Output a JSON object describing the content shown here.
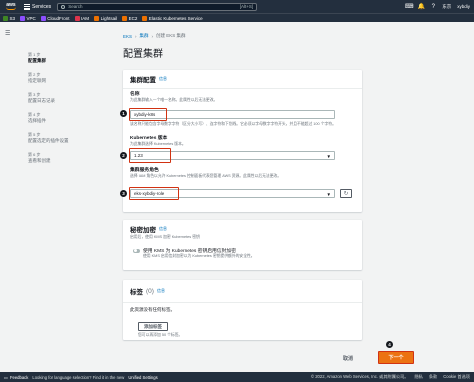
{
  "topnav": {
    "logo": "aws",
    "services_label": "Services",
    "search_placeholder": "Search",
    "search_shortcut": "[Alt+S]",
    "region": "东京",
    "user": "xybdiy"
  },
  "favorites": [
    {
      "label": "S3",
      "color": "#3f8624"
    },
    {
      "label": "VPC",
      "color": "#8c4fff"
    },
    {
      "label": "CloudFront",
      "color": "#8c4fff"
    },
    {
      "label": "IAM",
      "color": "#dd344c"
    },
    {
      "label": "Lightsail",
      "color": "#ed7100"
    },
    {
      "label": "EC2",
      "color": "#ed7100"
    },
    {
      "label": "Elastic Kubernetes Service",
      "color": "#ed7100"
    }
  ],
  "steps": [
    {
      "num": "第 1 步",
      "name": "配置集群"
    },
    {
      "num": "第 2 步",
      "name": "指定联网"
    },
    {
      "num": "第 3 步",
      "name": "配置日志记录"
    },
    {
      "num": "第 4 步",
      "name": "选择插件"
    },
    {
      "num": "第 5 步",
      "name": "配置选定的插件设置"
    },
    {
      "num": "第 6 步",
      "name": "查看和创建"
    }
  ],
  "breadcrumb": {
    "eks": "EKS",
    "clusters": "集群",
    "current": "创建 EKS 集群"
  },
  "page_title": "配置集群",
  "cluster_config": {
    "title": "集群配置",
    "info": "信息",
    "name_label": "名称",
    "name_desc": "为此集群输入一个唯一名称。此属性以后无法更改。",
    "name_value": "xybdiy-k8s",
    "name_hint": "该名称只能包含字母数字字符（区分大小写）、连字符和下划线。它必须以字母数字字符开头，并且不能超过 100 个字符。",
    "k8s_label": "Kubernetes 版本",
    "k8s_desc": "为此集群选择 Kubernetes 版本。",
    "k8s_value": "1.23",
    "role_label": "集群服务角色",
    "role_desc": "选择 IAM 角色以允许 Kubernetes 控制面板代表您管理 AWS 资源。此属性以后无法更改。",
    "role_value": "eks-xybdiy-role"
  },
  "secrets": {
    "title": "秘密加密",
    "info": "信息",
    "desc": "启用后，使用 KMS 加密 Kubernetes 密钥",
    "toggle_label": "使用 KMS 为 Kubernetes 密钥启用信封加密",
    "toggle_desc": "使用 KMS 启用信封加密以为 Kubernetes 密钥提供额外的安全性。"
  },
  "tags": {
    "title": "标签",
    "count": "(0)",
    "info": "信息",
    "empty": "此资源没有任何标签。",
    "add_button": "添加标签",
    "hint": "您可以再添加 50 个标签。"
  },
  "annotations": [
    "1",
    "2",
    "3",
    "4"
  ],
  "actions": {
    "cancel": "取消",
    "next": "下一个"
  },
  "footer": {
    "feedback": "Feedback",
    "language": "Looking for language selection? Find it in the new",
    "unified": "Unified Settings",
    "copyright": "© 2022, Amazon Web Services, Inc. 或其附属公司。",
    "privacy": "隐私",
    "terms": "条款",
    "cookies": "Cookie 首选项"
  }
}
